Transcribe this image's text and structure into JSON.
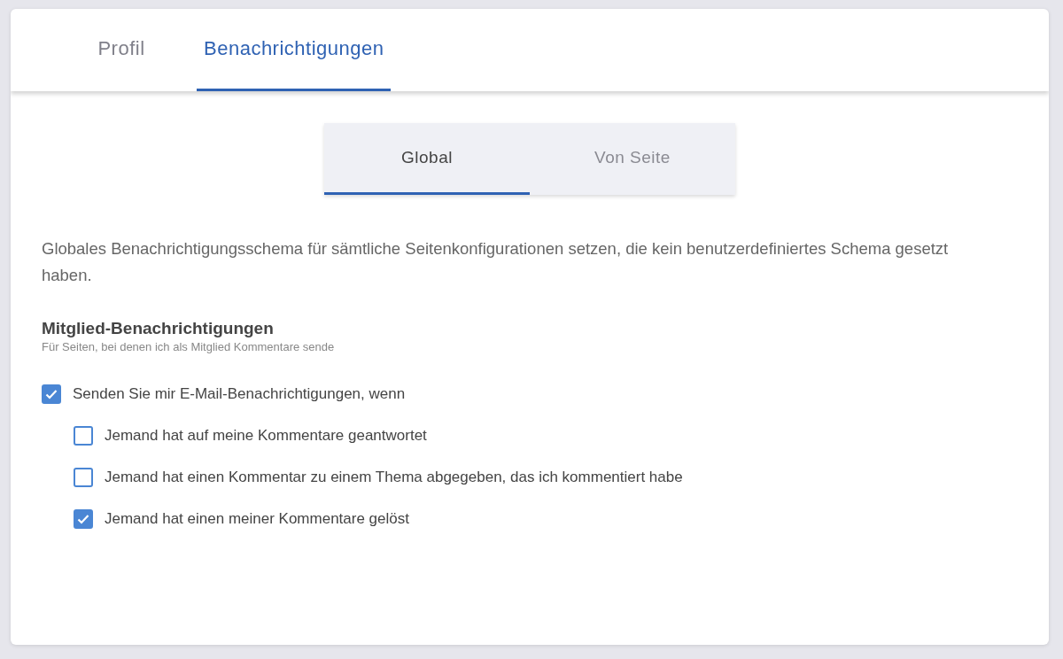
{
  "tabs": [
    {
      "label": "Profil",
      "selected": false
    },
    {
      "label": "Benachrichtigungen",
      "selected": true
    }
  ],
  "subtabs": [
    {
      "label": "Global",
      "selected": true
    },
    {
      "label": "Von Seite",
      "selected": false
    }
  ],
  "description": "Globales Benachrichtigungsschema für sämtliche Seitenkonfigurationen setzen, die kein benutzerdefiniertes Schema gesetzt haben.",
  "section": {
    "title": "Mitglied-Benachrichtigungen",
    "subtitle": "Für Seiten, bei denen ich als Mitglied Kommentare sende"
  },
  "options": [
    {
      "label": "Senden Sie mir E-Mail-Benachrichtigungen, wenn",
      "checked": true,
      "children": [
        {
          "label": "Jemand hat auf meine Kommentare geantwortet",
          "checked": false
        },
        {
          "label": "Jemand hat einen Kommentar zu einem Thema abgegeben, das ich kommentiert habe",
          "checked": false
        },
        {
          "label": "Jemand hat einen meiner Kommentare gelöst",
          "checked": true
        }
      ]
    }
  ]
}
